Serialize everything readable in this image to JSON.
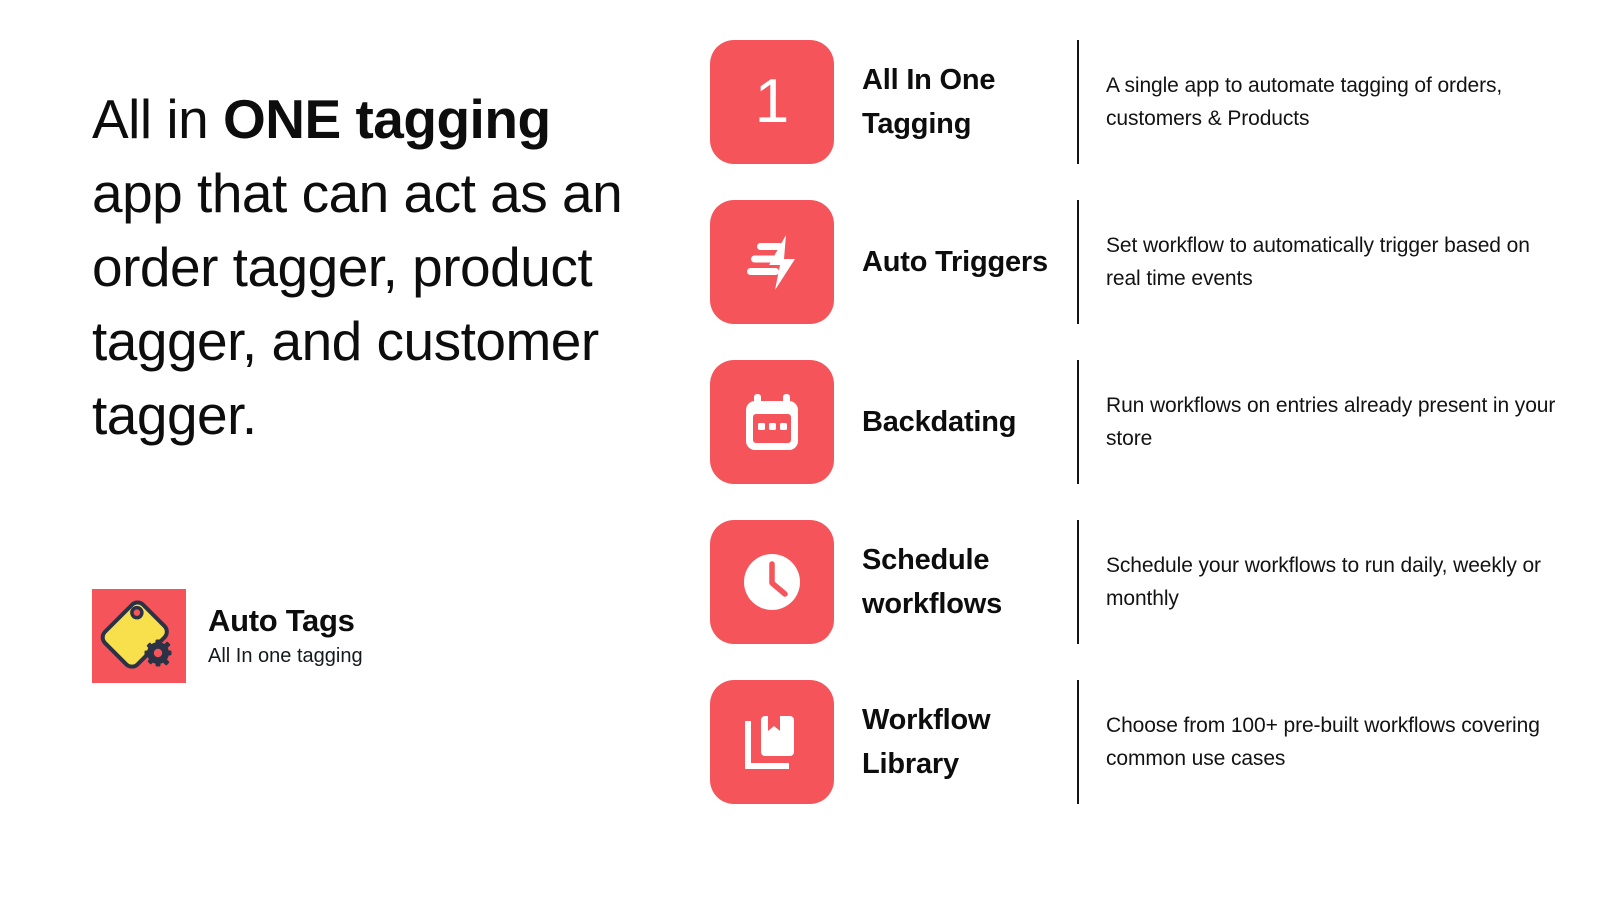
{
  "colors": {
    "brand_red": "#f4545a",
    "logo_yellow": "#f7e04b",
    "logo_dark": "#2b3245",
    "text_dark": "#0d0d0d",
    "background": "#ffffff"
  },
  "hero": {
    "headline_part1": "All in ",
    "headline_emphasis": "ONE tagging",
    "headline_part2": " app that can act as an order tagger, product tagger, and customer tagger."
  },
  "brand": {
    "logo_icon": "price-tag-gear-icon",
    "name": "Auto Tags",
    "tagline": "All In one tagging"
  },
  "features": [
    {
      "icon": "number-one-icon",
      "number": "1",
      "title": "All In One Tagging",
      "description": "A single app to automate tagging of orders, customers & Products"
    },
    {
      "icon": "lightning-bolt-icon",
      "title": "Auto Triggers",
      "description": "Set workflow to automatically trigger based on real time events"
    },
    {
      "icon": "calendar-icon",
      "title": "Backdating",
      "description": "Run workflows on entries already present in your store"
    },
    {
      "icon": "clock-icon",
      "title": "Schedule workflows",
      "description": "Schedule your workflows to run daily, weekly or monthly"
    },
    {
      "icon": "book-library-icon",
      "title": "Workflow Library",
      "description": "Choose from 100+ pre-built workflows covering common use cases"
    }
  ]
}
